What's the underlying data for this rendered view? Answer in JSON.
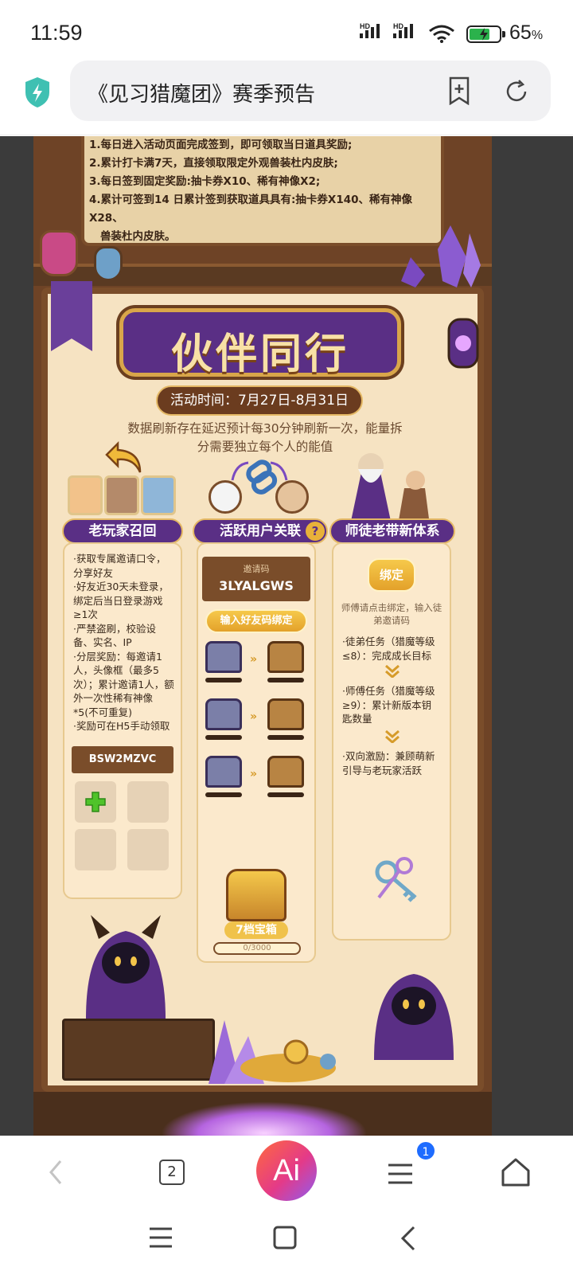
{
  "status_bar": {
    "time": "11:59",
    "network_tags": [
      "HD",
      "HD"
    ],
    "battery_percent": "65",
    "battery_unit": "%",
    "battery_level": 0.65,
    "icons": [
      "signal-icon",
      "signal-icon",
      "wifi-icon",
      "battery-charging-icon"
    ]
  },
  "browser": {
    "url_title": "《见习猎魔团》赛季预告",
    "icons": [
      "shield-icon",
      "add-bookmark-icon",
      "refresh-icon"
    ]
  },
  "rules": [
    "1.每日进入活动页面完成签到，即可领取当日道具奖励;",
    "2.累计打卡满7天，直接领取限定外观兽装杜内皮肤;",
    "3.每日签到固定奖励:抽卡券X10、稀有神像X2;",
    "4.累计可签到14 日累计签到获取道具具有:抽卡券X140、稀有神像X28、",
    "兽装杜内皮肤。"
  ],
  "event": {
    "title": "伙伴同行",
    "date": "活动时间：7月27日-8月31日",
    "notice": "数据刷新存在延迟预计每30分钟刷新一次，能量拆分需要独立每个人的能值"
  },
  "sections": {
    "recall": {
      "title": "老玩家召回",
      "lines": [
        "·获取专属邀请口令，分享好友",
        "·好友近30天未登录，绑定后当日登录游戏≥1次",
        "·严禁盗刷，校验设备、实名、IP",
        "·分层奖励：每邀请1人，头像框（最多5次）；累计邀请1人，额外一次性稀有神像*5(不可重复)",
        "·奖励可在H5手动领取"
      ],
      "code": "BSW2MZVC"
    },
    "link": {
      "title": "活跃用户关联",
      "help": "?",
      "invite_label": "邀请码",
      "invite_code": "3LYALGWS",
      "bind_friend_button": "输入好友码绑定",
      "chest_label": "7档宝箱",
      "progress": "0/3000",
      "progress_value": 0,
      "progress_max": 3000
    },
    "mentor": {
      "title": "师徒老带新体系",
      "bind_button": "绑定",
      "hint": "师傅请点击绑定，输入徒弟邀请码",
      "steps": [
        "·徒弟任务（猎魔等级≤8）：完成成长目标",
        "·师傅任务（猎魔等级≥9）：累计新版本钥匙数量",
        "·双向激励：兼顾萌新引导与老玩家活跃"
      ]
    }
  },
  "bottom_toolbar": {
    "tab_count": "2",
    "ai_label": "Ai",
    "menu_badge": "1",
    "icons": [
      "back-icon",
      "tabs-icon",
      "ai-icon",
      "menu-icon",
      "home-icon"
    ]
  },
  "system_nav": {
    "icons": [
      "recent-apps-icon",
      "home-square-icon",
      "back-icon"
    ]
  },
  "colors": {
    "purple": "#5a2f85",
    "gold": "#e4b865",
    "wood": "#7a4d2a",
    "parchment": "#f6e3c2",
    "accent_blue": "#1e6cff"
  }
}
